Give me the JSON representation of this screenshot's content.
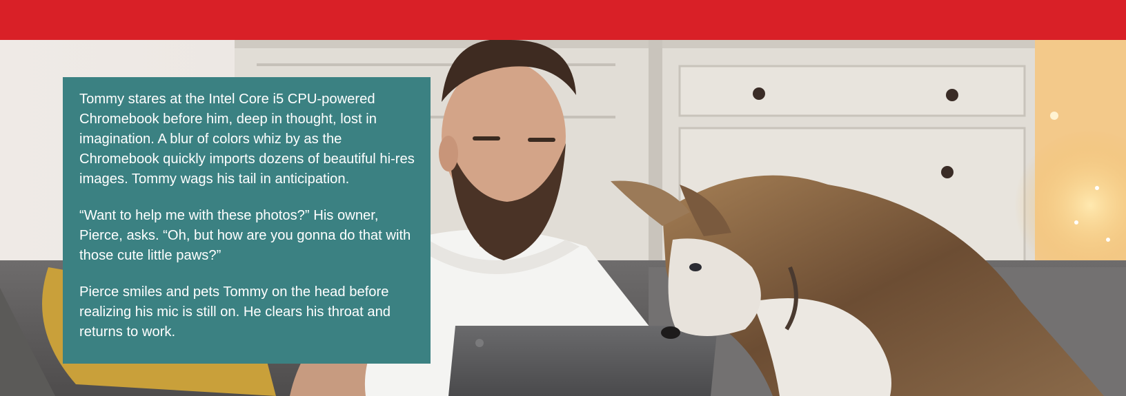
{
  "colors": {
    "banner": "#d92027",
    "caption_box": "#3b8182",
    "caption_text": "#ffffff"
  },
  "hero": {
    "image_subject": "photo-man-with-laptop-and-husky-dog"
  },
  "caption": {
    "paragraphs": [
      "Tommy stares at the Intel Core i5 CPU-powered Chromebook before him, deep in thought, lost in imagination. A blur of colors whiz by as the Chromebook quickly imports dozens of beautiful hi-res images. Tommy wags his tail in anticipation.",
      "“Want to help me with these photos?” His owner, Pierce, asks. “Oh, but how are you gonna do that with those cute little paws?”",
      "Pierce smiles and pets Tommy on the head before realizing his mic is still on. He clears his throat and returns to work."
    ]
  }
}
